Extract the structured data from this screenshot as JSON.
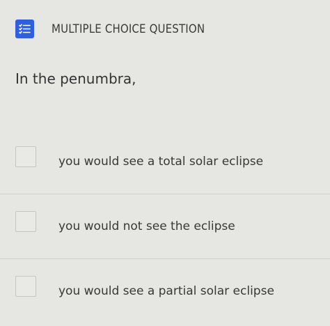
{
  "header": {
    "icon": "list-icon",
    "label": "MULTIPLE CHOICE QUESTION",
    "accent_color": "#2f5fe0"
  },
  "question": {
    "text": "In the penumbra,"
  },
  "options": [
    {
      "label": "you would see a total solar eclipse",
      "checked": false
    },
    {
      "label": "you would not see the eclipse",
      "checked": false
    },
    {
      "label": "you would see a partial solar eclipse",
      "checked": false
    }
  ]
}
